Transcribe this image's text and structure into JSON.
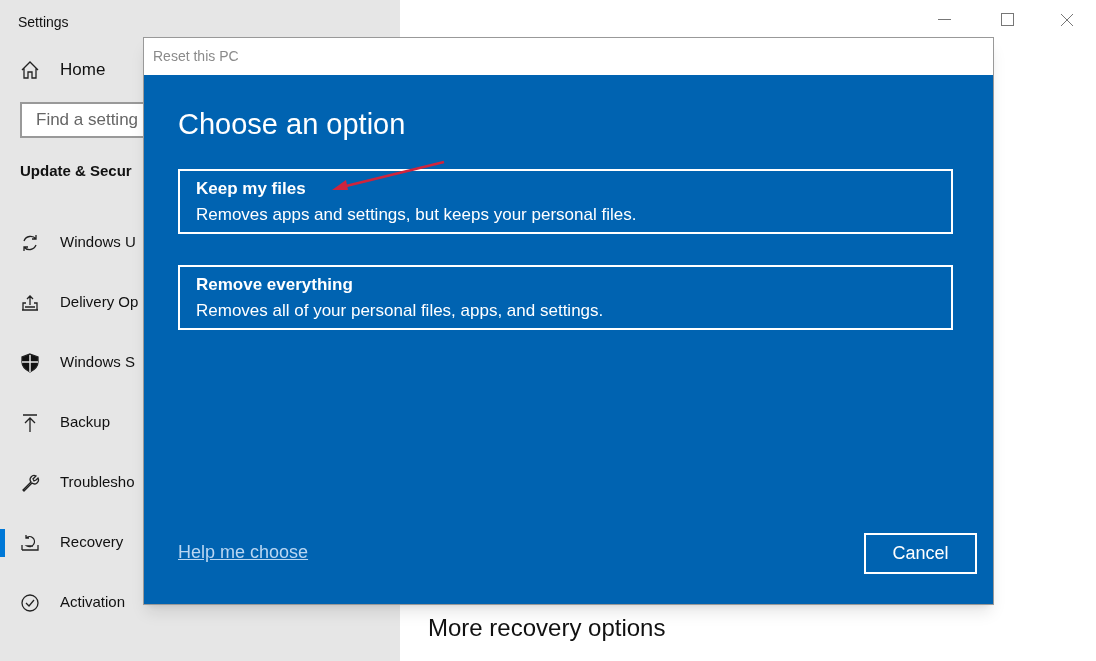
{
  "window": {
    "title": "Settings"
  },
  "sidebar": {
    "home": "Home",
    "search": {
      "placeholder": "Find a setting"
    },
    "section": "Update & Secur",
    "items": [
      {
        "label": "Windows U",
        "selected": false
      },
      {
        "label": "Delivery Op",
        "selected": false
      },
      {
        "label": "Windows S",
        "selected": false
      },
      {
        "label": "Backup",
        "selected": false
      },
      {
        "label": "Troublesho",
        "selected": false
      },
      {
        "label": "Recovery",
        "selected": true
      },
      {
        "label": "Activation",
        "selected": false
      }
    ]
  },
  "content": {
    "heading": "More recovery options"
  },
  "dialog": {
    "title": "Reset this PC",
    "heading": "Choose an option",
    "options": [
      {
        "title": "Keep my files",
        "description": "Removes apps and settings, but keeps your personal files."
      },
      {
        "title": "Remove everything",
        "description": "Removes all of your personal files, apps, and settings."
      }
    ],
    "help_link": "Help me choose",
    "cancel": "Cancel"
  }
}
